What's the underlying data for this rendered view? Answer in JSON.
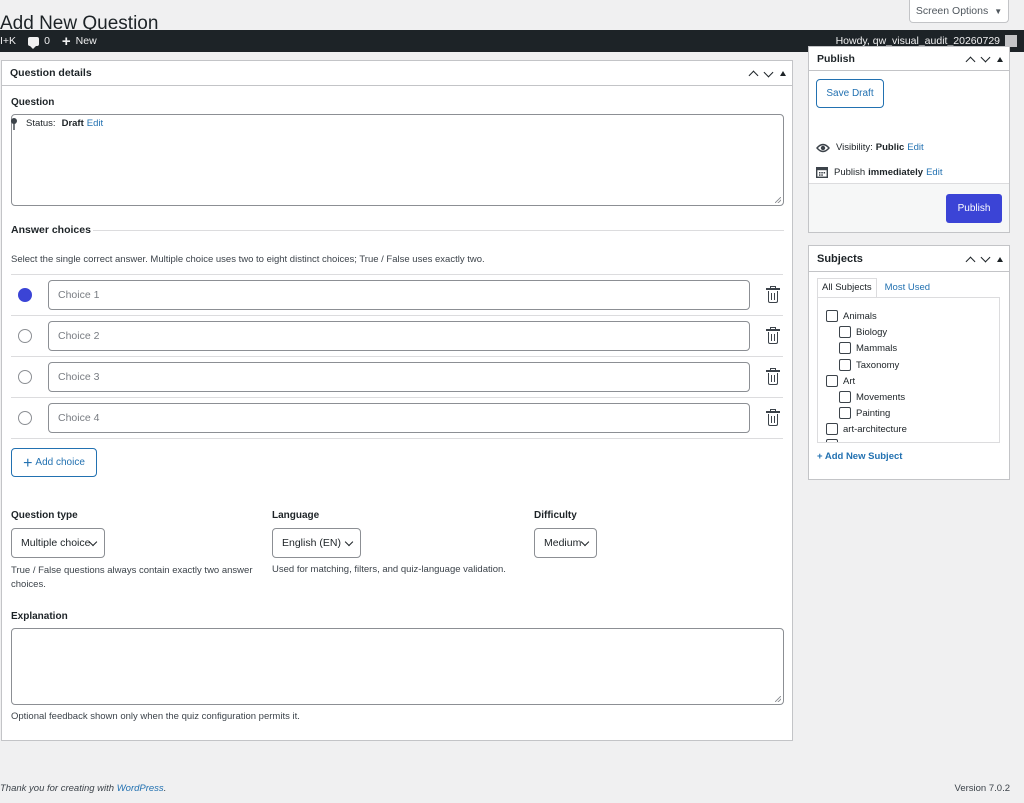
{
  "page": {
    "title": "Add New Question",
    "screen_options": "Screen Options"
  },
  "adminbar": {
    "shortcut": "I+K",
    "comments": "0",
    "new_label": "New",
    "howdy": "Howdy, qw_visual_audit_20260729"
  },
  "question_box": {
    "title": "Question details",
    "question_label": "Question",
    "answers_heading": "Answer choices",
    "answers_hint": "Select the single correct answer. Multiple choice uses two to eight distinct choices; True / False uses exactly two.",
    "choices": [
      {
        "placeholder": "Choice 1",
        "selected": true
      },
      {
        "placeholder": "Choice 2",
        "selected": false
      },
      {
        "placeholder": "Choice 3",
        "selected": false
      },
      {
        "placeholder": "Choice 4",
        "selected": false
      }
    ],
    "add_choice": "Add choice",
    "type_label": "Question type",
    "type_value": "Multiple choice",
    "type_hint": "True / False questions always contain exactly two answer choices.",
    "language_label": "Language",
    "language_value": "English (EN)",
    "language_hint": "Used for matching, filters, and quiz-language validation.",
    "difficulty_label": "Difficulty",
    "difficulty_value": "Medium",
    "explanation_label": "Explanation",
    "explanation_hint": "Optional feedback shown only when the quiz configuration permits it."
  },
  "publish_box": {
    "title": "Publish",
    "save_draft": "Save Draft",
    "status_label": "Status:",
    "status_value": "Draft",
    "visibility_label": "Visibility:",
    "visibility_value": "Public",
    "schedule_label": "Publish",
    "schedule_value": "immediately",
    "edit": "Edit",
    "publish": "Publish"
  },
  "subjects_box": {
    "title": "Subjects",
    "tab_all": "All Subjects",
    "tab_used": "Most Used",
    "items": [
      {
        "label": "Animals",
        "level": 0
      },
      {
        "label": "Biology",
        "level": 1
      },
      {
        "label": "Mammals",
        "level": 1
      },
      {
        "label": "Taxonomy",
        "level": 1
      },
      {
        "label": "Art",
        "level": 0
      },
      {
        "label": "Movements",
        "level": 1
      },
      {
        "label": "Painting",
        "level": 1
      },
      {
        "label": "art-architecture",
        "level": 0
      }
    ],
    "add_new": "+ Add New Subject"
  },
  "footer": {
    "thanks_prefix": "Thank you for creating with ",
    "thanks_link": "WordPress",
    "thanks_suffix": ".",
    "version": "Version 7.0.2"
  },
  "colors": {
    "primary": "#3b44d6",
    "link": "#2271b1",
    "adminbar": "#1d2327"
  }
}
